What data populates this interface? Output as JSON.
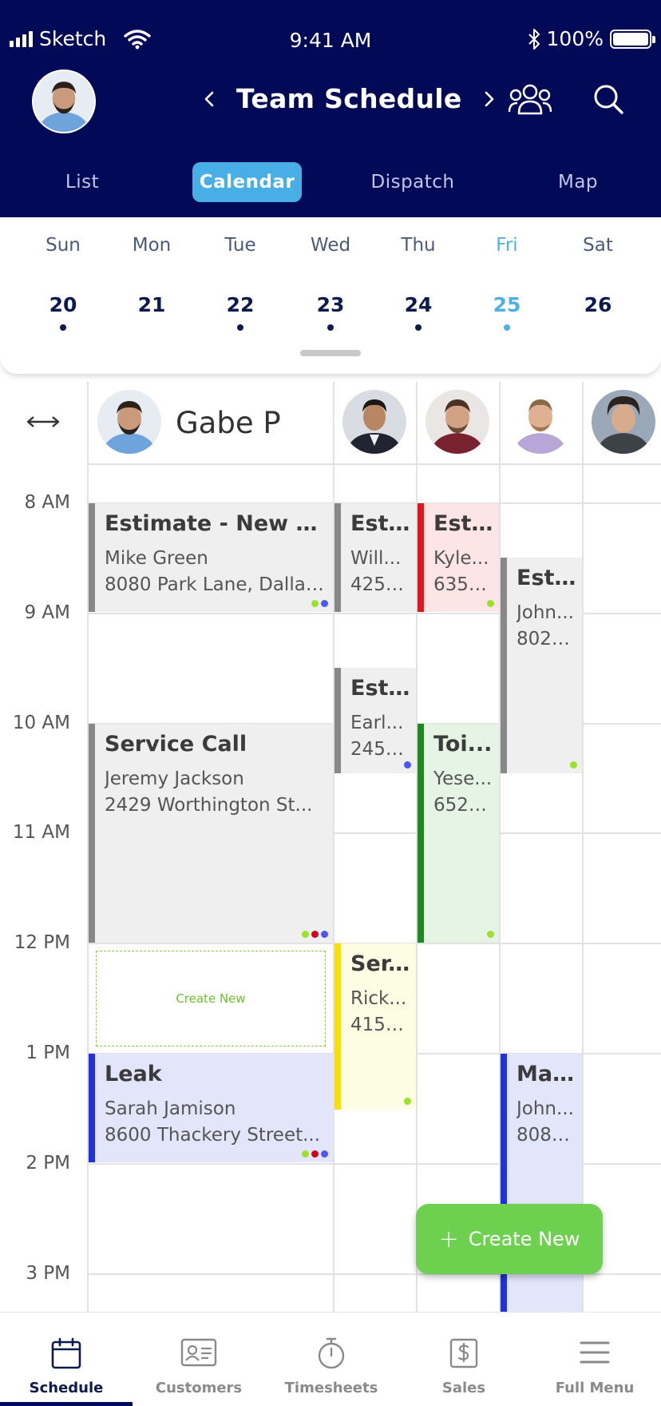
{
  "status_bar": {
    "carrier": "Sketch",
    "time": "9:41 AM",
    "battery": "100%"
  },
  "header": {
    "title": "Team Schedule"
  },
  "tabs": [
    {
      "label": "List",
      "active": false
    },
    {
      "label": "Calendar",
      "active": true
    },
    {
      "label": "Dispatch",
      "active": false
    },
    {
      "label": "Map",
      "active": false
    }
  ],
  "week": [
    {
      "day": "Sun",
      "date": "20",
      "has_events": true,
      "selected": false
    },
    {
      "day": "Mon",
      "date": "21",
      "has_events": false,
      "selected": false
    },
    {
      "day": "Tue",
      "date": "22",
      "has_events": true,
      "selected": false
    },
    {
      "day": "Wed",
      "date": "23",
      "has_events": true,
      "selected": false
    },
    {
      "day": "Thu",
      "date": "24",
      "has_events": true,
      "selected": false
    },
    {
      "day": "Fri",
      "date": "25",
      "has_events": true,
      "selected": true
    },
    {
      "day": "Sat",
      "date": "26",
      "has_events": false,
      "selected": false
    }
  ],
  "team": {
    "primary_name": "Gabe P"
  },
  "time_labels": [
    "8 AM",
    "9 AM",
    "10 AM",
    "11 AM",
    "12 PM",
    "1 PM",
    "2 PM",
    "3 PM"
  ],
  "events": [
    {
      "title": "Estimate - New Ta...",
      "line1": "Mike Green",
      "line2": "8080 Park Lane, Dallas...",
      "color": "gray"
    },
    {
      "title": "Service Call",
      "line1": "Jeremy Jackson",
      "line2": "2429 Worthington St...",
      "color": "gray"
    },
    {
      "title": "Leak",
      "line1": "Sarah Jamison",
      "line2": "8600 Thackery Street...",
      "color": "blue"
    },
    {
      "title": "Esti...",
      "line1": "Will...",
      "line2": "4255...",
      "color": "gray"
    },
    {
      "title": "Esti...",
      "line1": "Earl...",
      "line2": "2451...",
      "color": "gray"
    },
    {
      "title": "Ser...",
      "line1": "Rick...",
      "line2": "4152...",
      "color": "yellow"
    },
    {
      "title": "Esti...",
      "line1": "Kyle...",
      "line2": "6355...",
      "color": "red"
    },
    {
      "title": "Toi...",
      "line1": "Yese...",
      "line2": "6524...",
      "color": "green"
    },
    {
      "title": "Esti...",
      "line1": "John...",
      "line2": "8023...",
      "color": "gray"
    },
    {
      "title": "Mai...",
      "line1": "John...",
      "line2": "8080...",
      "color": "blue"
    }
  ],
  "create_slot_label": "Create New",
  "fab_label": "Create New",
  "bottom_nav": [
    {
      "label": "Schedule",
      "icon": "calendar-icon",
      "active": true
    },
    {
      "label": "Customers",
      "icon": "contact-card-icon",
      "active": false
    },
    {
      "label": "Timesheets",
      "icon": "stopwatch-icon",
      "active": false
    },
    {
      "label": "Sales",
      "icon": "dollar-document-icon",
      "active": false
    },
    {
      "label": "Full Menu",
      "icon": "hamburger-menu-icon",
      "active": false
    }
  ],
  "colors": {
    "header_bg": "#020a57",
    "tab_active": "#47afe6",
    "selected_day": "#4fb1e3",
    "fab": "#6dd04e",
    "dot_green": "#9be22a",
    "dot_red": "#d0021b",
    "dot_blue": "#4a57f0"
  }
}
